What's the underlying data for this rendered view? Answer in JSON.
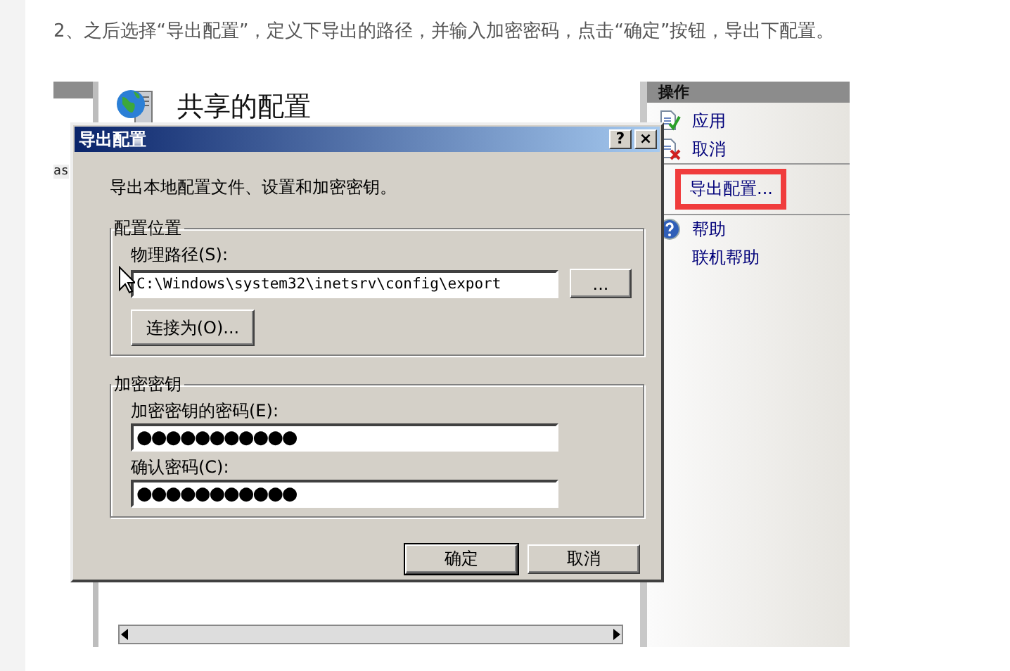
{
  "article": {
    "instruction": "2、之后选择“导出配置”，定义下导出的路径，并输入加密密码，点击“确定”按钮，导出下配置。"
  },
  "screenshot": {
    "left_pane": {
      "text": "as"
    },
    "main_pane": {
      "title": "共享的配置"
    },
    "actions_pane": {
      "header": "操作",
      "items": [
        {
          "label": "应用",
          "kind": "apply",
          "highlighted": false
        },
        {
          "label": "取消",
          "kind": "cancel",
          "highlighted": false
        },
        {
          "label": "导出配置...",
          "kind": "plain",
          "highlighted": true
        },
        {
          "label": "帮助",
          "kind": "help",
          "highlighted": false
        },
        {
          "label": "联机帮助",
          "kind": "plain",
          "highlighted": false
        }
      ]
    },
    "dialog": {
      "title": "导出配置",
      "title_buttons": [
        "?",
        "×"
      ],
      "description": "导出本地配置文件、设置和加密密钥。",
      "location_group": {
        "legend": "配置位置",
        "path_label": "物理路径(S):",
        "path_value": "C:\\Windows\\system32\\inetsrv\\config\\export",
        "browse_button": "...",
        "connect_button": "连接为(O)..."
      },
      "key_group": {
        "legend": "加密密钥",
        "password_label": "加密密钥的密码(E):",
        "password_value": "●●●●●●●●●●●",
        "confirm_label": "确认密码(C):",
        "confirm_value": "●●●●●●●●●●●"
      },
      "buttons": [
        {
          "label": "确定",
          "default": true
        },
        {
          "label": "取消",
          "default": false
        }
      ]
    }
  }
}
